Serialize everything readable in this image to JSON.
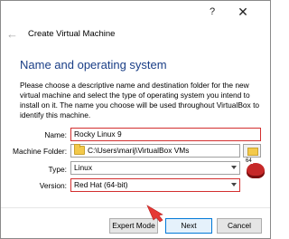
{
  "window": {
    "help_glyph": "?",
    "close_glyph": "✕"
  },
  "dialog": {
    "title": "Create Virtual Machine",
    "back_glyph": "←"
  },
  "page": {
    "heading": "Name and operating system",
    "description": "Please choose a descriptive name and destination folder for the new virtual machine and select the type of operating system you intend to install on it. The name you choose will be used throughout VirtualBox to identify this machine."
  },
  "form": {
    "name_label": "Name:",
    "name_value": "Rocky Linux 9",
    "folder_label": "Machine Folder:",
    "folder_value": "C:\\Users\\marij\\VirtualBox VMs",
    "type_label": "Type:",
    "type_value": "Linux",
    "version_label": "Version:",
    "version_value": "Red Hat (64-bit)",
    "os_badge_text": "64"
  },
  "buttons": {
    "expert": "Expert Mode",
    "next": "Next",
    "cancel": "Cancel"
  },
  "colors": {
    "highlight": "#d32f2f",
    "heading": "#1a3e86",
    "cursor_arrow": "#e53935"
  },
  "icons": {
    "folder": "folder-icon",
    "browse": "folder-browse-icon",
    "os": "redhat-os-icon",
    "pointer": "red-arrow-pointer"
  }
}
